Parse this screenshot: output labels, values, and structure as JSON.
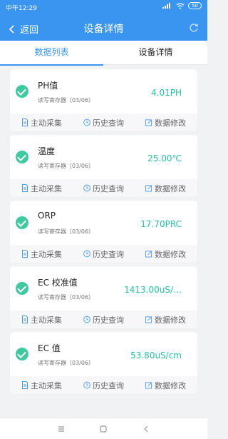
{
  "status_bar": {
    "time": "中午12:29",
    "battery": "50"
  },
  "header": {
    "back_label": "返回",
    "title": "设备详情"
  },
  "tabs": [
    {
      "label": "数据列表",
      "active": true
    },
    {
      "label": "设备详情",
      "active": false
    }
  ],
  "actions": {
    "collect": "主动采集",
    "history": "历史查询",
    "modify": "数据修改"
  },
  "items": [
    {
      "name": "PH值",
      "subtitle": "读写寄存器（03/06）",
      "value": "4.01PH"
    },
    {
      "name": "温度",
      "subtitle": "读写寄存器（03/06）",
      "value": "25.00℃"
    },
    {
      "name": "ORP",
      "subtitle": "读写寄存器（03/06）",
      "value": "17.70PRC"
    },
    {
      "name": "EC 校准值",
      "subtitle": "读写寄存器（03/06）",
      "value": "1413.00uS/…"
    },
    {
      "name": "EC 值",
      "subtitle": "读写寄存器（03/06）",
      "value": "53.80uS/cm"
    }
  ],
  "colors": {
    "primary": "#3a95f0",
    "accent_green": "#40c9a1",
    "value_text": "#26bfa3"
  },
  "icons": {
    "back": "chevron-left-icon",
    "refresh": "refresh-icon",
    "collect": "document-icon",
    "history": "clock-icon",
    "modify": "edit-icon"
  }
}
